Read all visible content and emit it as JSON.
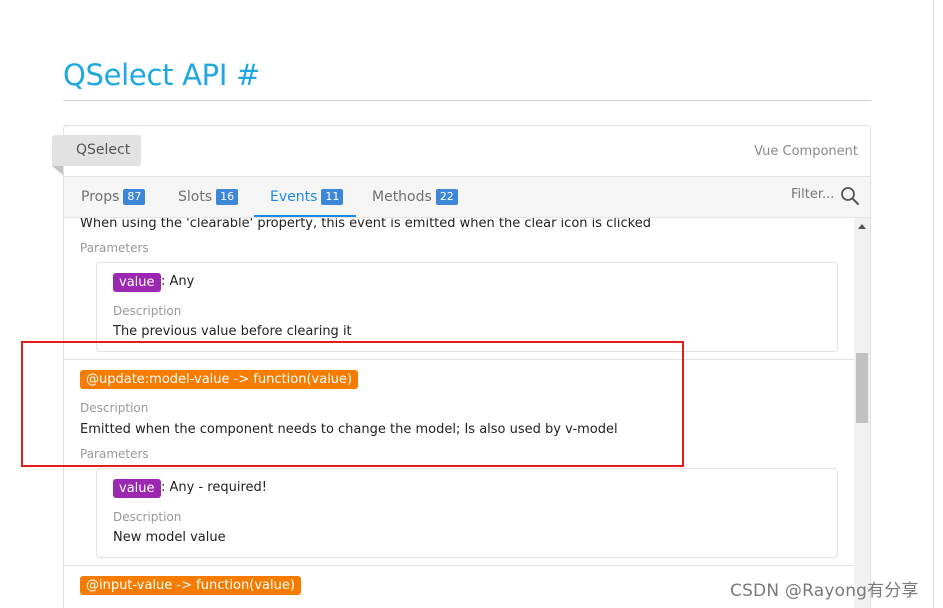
{
  "page": {
    "title": "QSelect API #"
  },
  "component": {
    "name": "QSelect",
    "type": "Vue Component"
  },
  "tabs": [
    {
      "label": "Props",
      "count": "87",
      "active": false
    },
    {
      "label": "Slots",
      "count": "16",
      "active": false
    },
    {
      "label": "Events",
      "count": "11",
      "active": true
    },
    {
      "label": "Methods",
      "count": "22",
      "active": false
    }
  ],
  "filter": {
    "placeholder": "Filter..."
  },
  "events": {
    "clear": {
      "description": "When using the 'clearable' property, this event is emitted when the clear icon is clicked",
      "parameters_label": "Parameters",
      "param": {
        "name": "value",
        "type": ": Any",
        "description_label": "Description",
        "description": "The previous value before clearing it"
      }
    },
    "update_model_value": {
      "signature": "@update:model-value -> function(value)",
      "description_label": "Description",
      "description": "Emitted when the component needs to change the model; Is also used by v-model",
      "parameters_label": "Parameters",
      "param": {
        "name": "value",
        "type": ": Any - required!",
        "description_label": "Description",
        "description": "New model value"
      }
    },
    "input_value": {
      "signature": "@input-value -> function(value)"
    }
  },
  "watermark": "CSDN @Rayong有分享",
  "colors": {
    "accent_blue": "#1fa8e0",
    "tab_active": "#1e88e5",
    "badge_blue": "#3d86d8",
    "chip_purple": "#9c27b0",
    "chip_orange": "#f57c00",
    "highlight_red": "#e31c1c"
  }
}
